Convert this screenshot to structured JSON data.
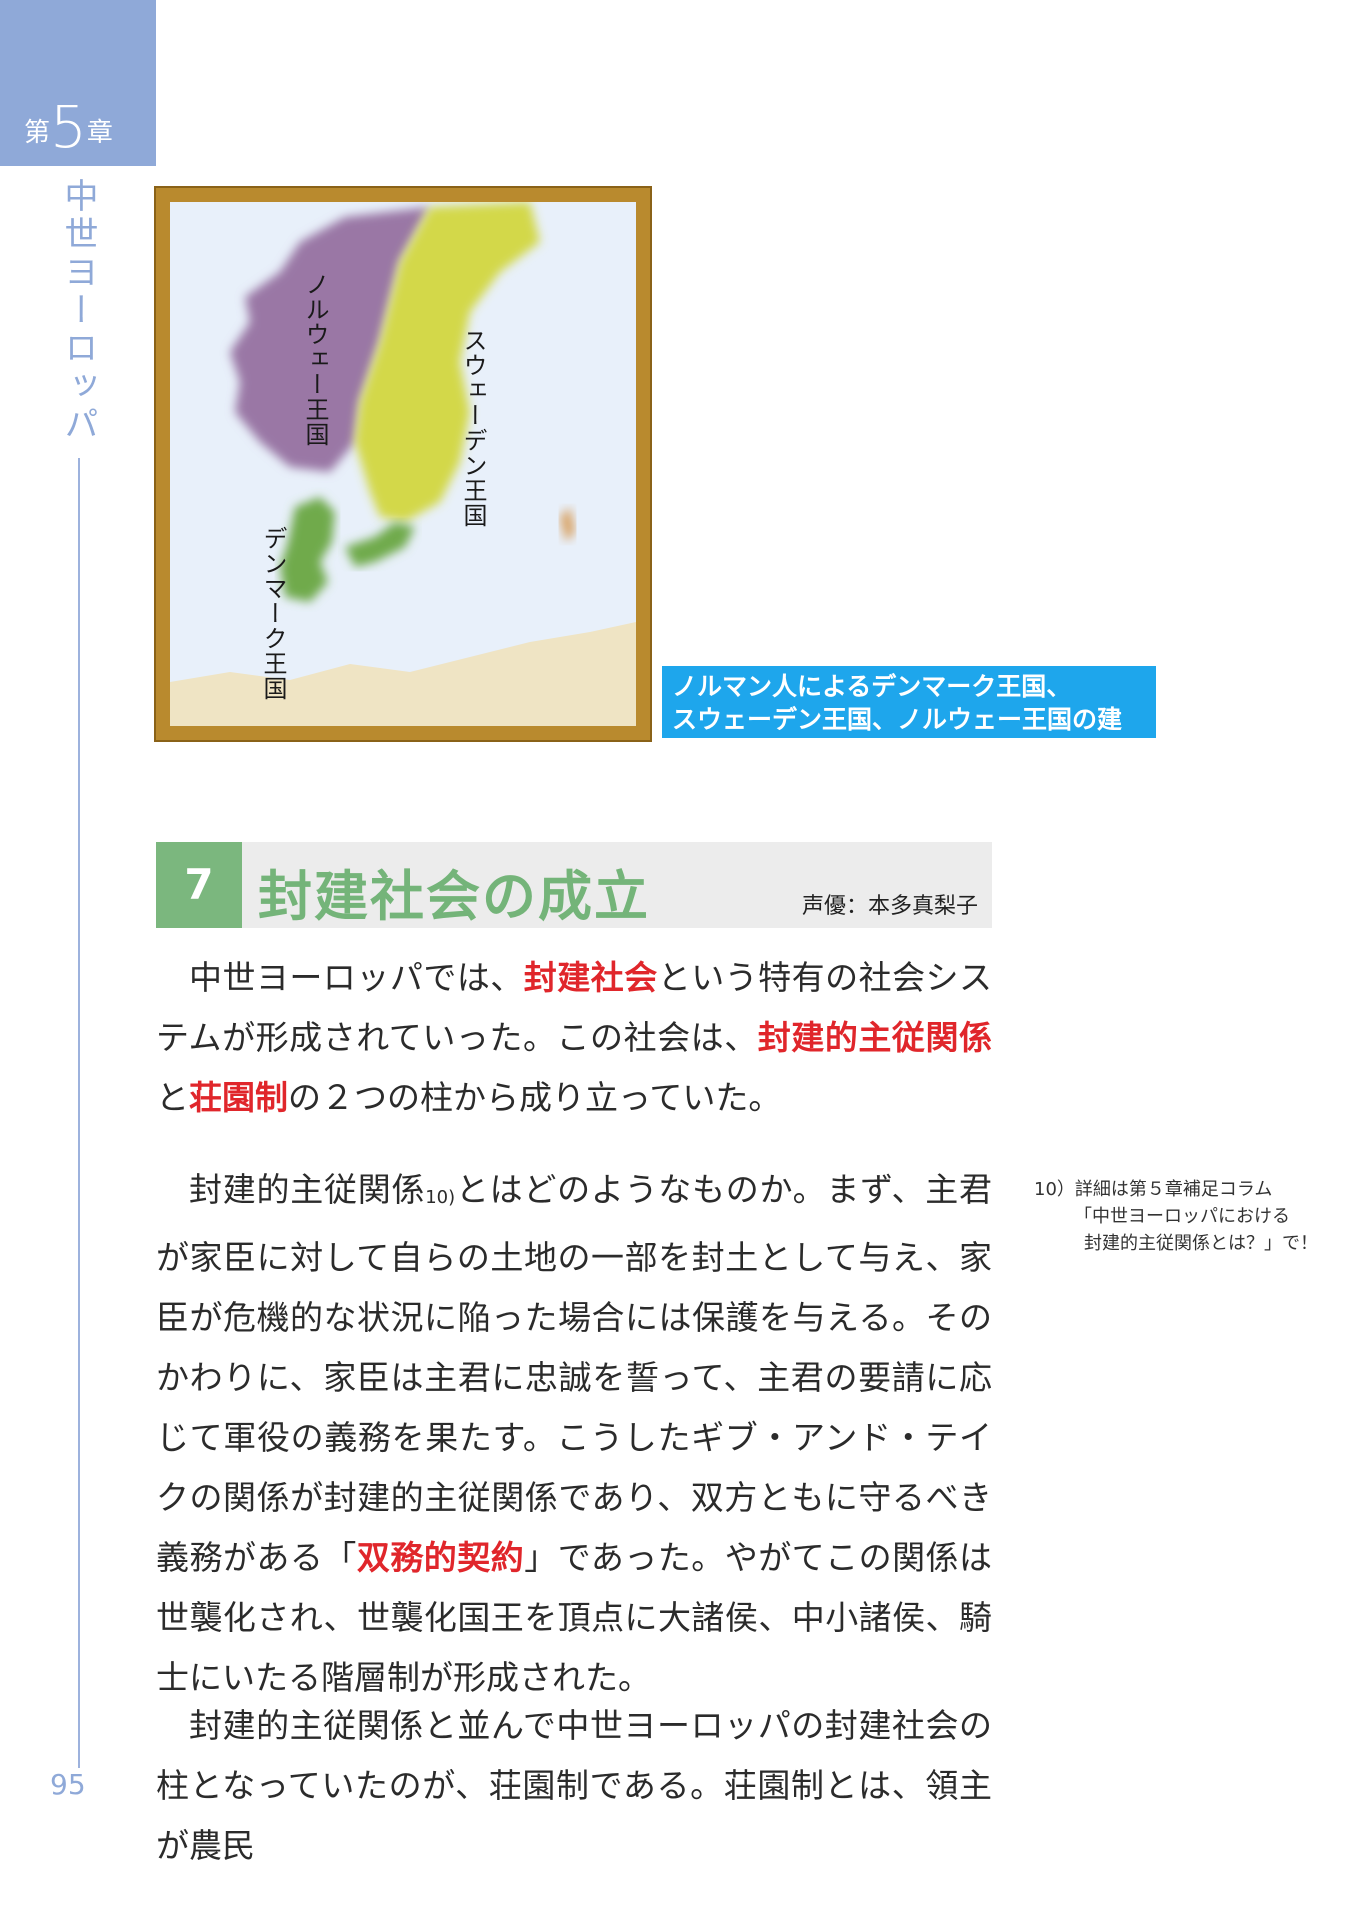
{
  "chapter": {
    "prefix": "第",
    "number": "5",
    "suffix": "章",
    "title": "中世ヨーロッパ"
  },
  "page_number": "95",
  "map": {
    "labels": {
      "norway": "ノルウェー王国",
      "sweden": "スウェーデン王国",
      "denmark": "デンマーク王国"
    },
    "caption_line1": "ノルマン人によるデンマーク王国、",
    "caption_line2": "スウェーデン王国、ノルウェー王国の建国",
    "colors": {
      "norway": "#9a77a5",
      "sweden": "#d3d84a",
      "denmark": "#6faa4c",
      "sea": "#e8f0fa",
      "land": "#efe4c4"
    }
  },
  "section": {
    "number": "7",
    "title": "封建社会の成立",
    "voice": "声優：本多真梨子"
  },
  "paragraph1": {
    "t1": "中世ヨーロッパでは、",
    "k1": "封建社会",
    "t2": "という特有の社会システムが形成されていった。この社会は、",
    "k2": "封建的主従関係",
    "t3": "と",
    "k3": "荘園制",
    "t4": "の２つの柱から成り立っていた。"
  },
  "paragraph2": {
    "t1": "封建的主従関係",
    "ref": "10)",
    "t2": "とはどのようなものか。まず、主君が家臣に対して自らの土地の一部を封土として与え、家臣が危機的な状況に陥った場合には保護を与える。そのかわりに、家臣は主君に忠誠を誓って、主君の要請に応じて軍役の義務を果たす。こうしたギブ・アンド・テイクの関係が封建的主従関係であり、双方ともに守るべき義務がある「",
    "k1": "双務的契約",
    "t3": "」であった。やがてこの関係は世襲化され、世襲化国王を頂点に大諸侯、中小諸侯、騎士にいたる階層制が形成された。"
  },
  "paragraph3": {
    "t1": "封建的主従関係と並んで中世ヨーロッパの封建社会の柱となっていたのが、荘園制である。荘園制とは、領主が農民"
  },
  "footnote": {
    "line1": "10）詳細は第５章補足コラム",
    "line2": "「中世ヨーロッパにおける",
    "line3": "封建的主従関係とは？」で！"
  }
}
